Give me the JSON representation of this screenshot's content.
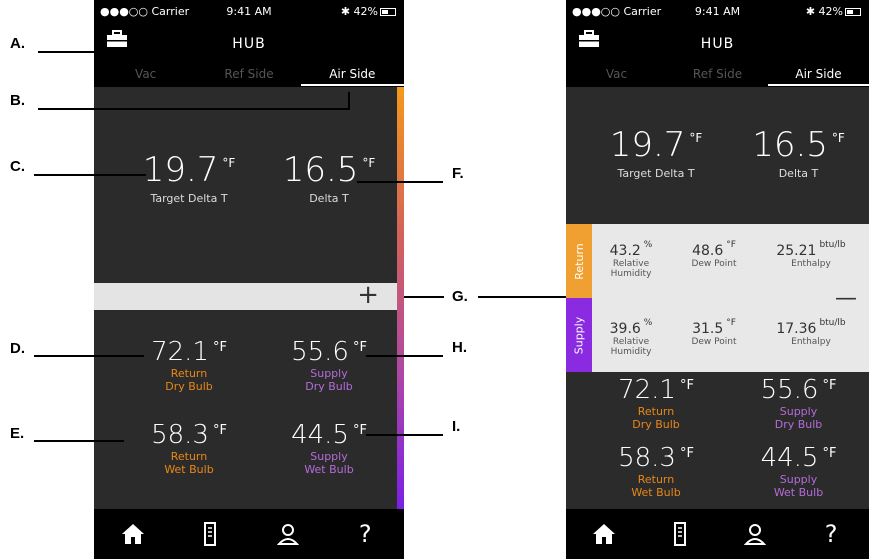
{
  "status_bar": {
    "carrier": "●●●○○ Carrier",
    "time": "9:41 AM",
    "battery": "42%"
  },
  "header": {
    "title": "HUB"
  },
  "tabs": [
    "Vac",
    "Ref Side",
    "Air Side"
  ],
  "active_tab": "Air Side",
  "main": {
    "target_delta_t": {
      "value": "19.7",
      "unit": "°F",
      "label": "Target Delta T"
    },
    "delta_t": {
      "value": "16.5",
      "unit": "°F",
      "label": "Delta T"
    }
  },
  "readings": {
    "return_dry": {
      "value": "72.1",
      "unit": "°F",
      "label1": "Return",
      "label2": "Dry Bulb"
    },
    "supply_dry": {
      "value": "55.6",
      "unit": "°F",
      "label1": "Supply",
      "label2": "Dry Bulb"
    },
    "return_wet": {
      "value": "58.3",
      "unit": "°F",
      "label1": "Return",
      "label2": "Wet Bulb"
    },
    "supply_wet": {
      "value": "44.5",
      "unit": "°F",
      "label1": "Supply",
      "label2": "Wet Bulb"
    }
  },
  "panel": {
    "return_label": "Return",
    "supply_label": "Supply",
    "return": {
      "rh": {
        "value": "43.2",
        "unit": "%",
        "label1": "Relative",
        "label2": "Humidity"
      },
      "dew": {
        "value": "48.6",
        "unit": "°F",
        "label": "Dew Point"
      },
      "enthalpy": {
        "value": "25.21",
        "unit": "btu/lb",
        "label": "Enthalpy"
      }
    },
    "supply": {
      "rh": {
        "value": "39.6",
        "unit": "%",
        "label1": "Relative",
        "label2": "Humidity"
      },
      "dew": {
        "value": "31.5",
        "unit": "°F",
        "label": "Dew Point"
      },
      "enthalpy": {
        "value": "17.36",
        "unit": "btu/lb",
        "label": "Enthalpy"
      }
    }
  },
  "nav": {
    "icons": [
      "home-icon",
      "meter-icon",
      "user-icon",
      "help-icon"
    ],
    "help_glyph": "?"
  },
  "annotations": [
    "A.",
    "B.",
    "C.",
    "D.",
    "E.",
    "F.",
    "G.",
    "H.",
    "I."
  ],
  "colors": {
    "return": "#e88718",
    "supply": "#b56bd9",
    "gradient_top": "#f39a1a",
    "gradient_bottom": "#7a1fe8"
  }
}
